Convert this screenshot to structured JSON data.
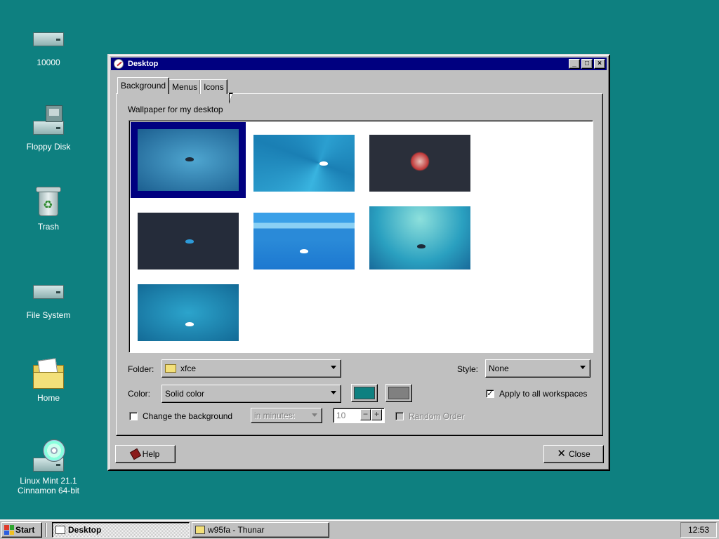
{
  "desktop": {
    "background_color": "#0e8080",
    "icons": [
      {
        "label": "10000",
        "icon": "drive-icon"
      },
      {
        "label": "Floppy Disk",
        "icon": "floppy-drive-icon"
      },
      {
        "label": "Trash",
        "icon": "trash-icon"
      },
      {
        "label": "File System",
        "icon": "drive-icon"
      },
      {
        "label": "Home",
        "icon": "home-folder-icon"
      },
      {
        "label_line1": "Linux Mint 21.1",
        "label_line2": "Cinnamon 64-bit",
        "icon": "cd-drive-icon"
      }
    ]
  },
  "window": {
    "title": "Desktop",
    "title_icon": "desktop-settings-icon",
    "buttons": {
      "minimize": "_",
      "maximize": "□",
      "close": "×"
    },
    "tabs": [
      {
        "label": "Background",
        "active": true
      },
      {
        "label": "Menus",
        "active": false
      },
      {
        "label": "Icons",
        "active": false
      }
    ],
    "wallpaper_label": "Wallpaper for my desktop",
    "wallpapers": [
      {
        "name": "xfce-blue-selected",
        "selected": true
      },
      {
        "name": "xfce-swirl",
        "selected": false
      },
      {
        "name": "xfce-flower",
        "selected": false
      },
      {
        "name": "xfce-dark",
        "selected": false
      },
      {
        "name": "xfce-stripes",
        "selected": false
      },
      {
        "name": "xfce-teal",
        "selected": false
      },
      {
        "name": "xfce-blue",
        "selected": false
      }
    ],
    "folder": {
      "label": "Folder:",
      "value": "xfce"
    },
    "style": {
      "label": "Style:",
      "value": "None"
    },
    "color": {
      "label": "Color:",
      "value": "Solid color",
      "primary": "#0e8080",
      "secondary": "#808080"
    },
    "apply_all": {
      "label": "Apply to all workspaces",
      "checked": true
    },
    "change_bg": {
      "label": "Change the background",
      "checked": false
    },
    "interval_unit": {
      "value": "in minutes:",
      "enabled": false
    },
    "interval_value": {
      "value": "10",
      "minus": "−",
      "plus": "+"
    },
    "random_order": {
      "label": "Random Order",
      "checked": false,
      "enabled": false
    },
    "help_button": "Help",
    "close_button": "Close"
  },
  "taskbar": {
    "start_label": "Start",
    "items": [
      {
        "label": "Desktop",
        "active": true
      },
      {
        "label": "w95fa - Thunar",
        "active": false
      }
    ],
    "clock": "12:53"
  }
}
